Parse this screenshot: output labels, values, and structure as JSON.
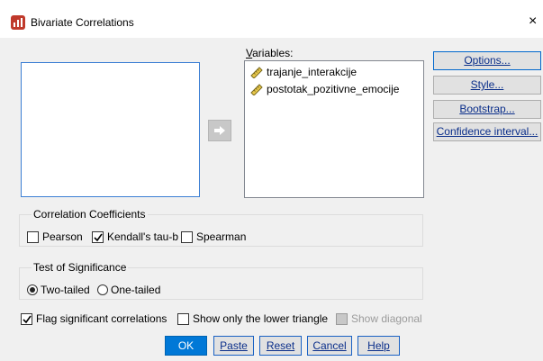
{
  "window": {
    "title": "Bivariate Correlations",
    "close_glyph": "×",
    "app_icon": "spss-app-icon"
  },
  "source_list": {
    "items": []
  },
  "variables": {
    "label": "Variables:",
    "items": [
      {
        "name": "trajanje_interakcije",
        "icon": "scale-ruler-icon"
      },
      {
        "name": "postotak_pozitivne_emocije",
        "icon": "scale-ruler-icon"
      }
    ]
  },
  "move_button": {
    "icon": "move-right-arrow-icon"
  },
  "side_buttons": {
    "options": "Options...",
    "style": "Style...",
    "bootstrap": "Bootstrap...",
    "confidence": "Confidence interval..."
  },
  "correlation_coefficients": {
    "title": "Correlation Coefficients",
    "pearson": {
      "label": "Pearson",
      "checked": false
    },
    "kendall": {
      "label": "Kendall's tau-b",
      "checked": true
    },
    "spearman": {
      "label": "Spearman",
      "checked": false
    }
  },
  "test_of_significance": {
    "title": "Test of Significance",
    "two_tailed": {
      "label": "Two-tailed",
      "selected": true
    },
    "one_tailed": {
      "label": "One-tailed",
      "selected": false
    }
  },
  "options_row": {
    "flag": {
      "label": "Flag significant correlations",
      "checked": true
    },
    "lower_triangle": {
      "label": "Show only the lower triangle",
      "checked": false
    },
    "diagonal": {
      "label": "Show diagonal",
      "checked": false,
      "disabled": true
    }
  },
  "buttons": {
    "ok": "OK",
    "paste": "Paste",
    "reset": "Reset",
    "cancel": "Cancel",
    "help": "Help"
  },
  "colors": {
    "accent": "#0078d7",
    "link_text": "#0a2e8a",
    "focus_border": "#3c7fd4"
  }
}
